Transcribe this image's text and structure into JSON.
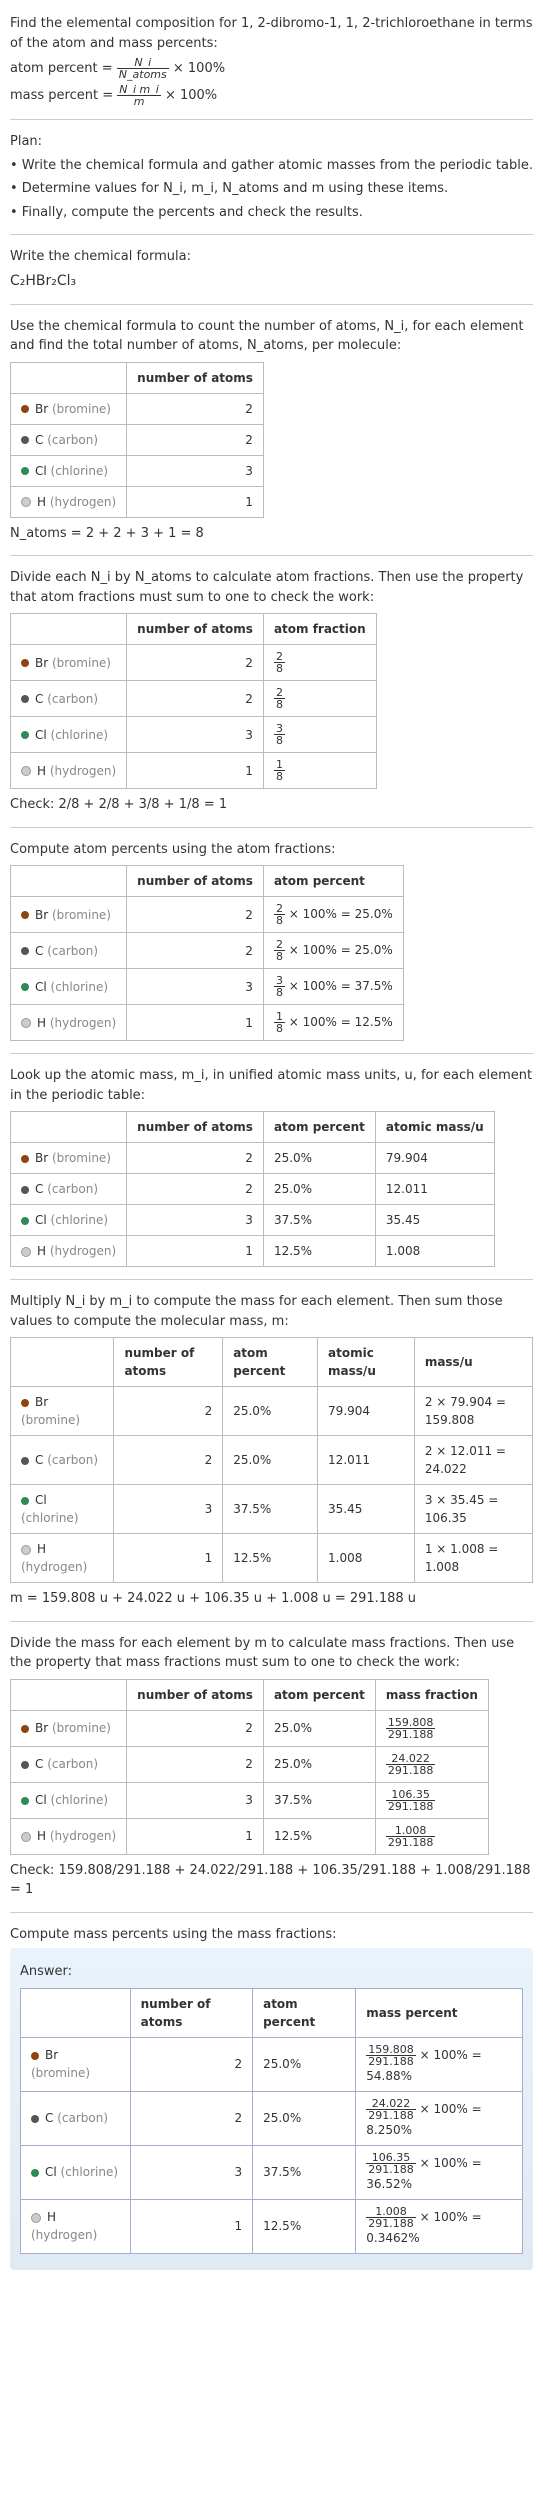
{
  "intro": {
    "title": "Find the elemental composition for 1, 2-dibromo-1, 1, 2-trichloroethane in terms of the atom and mass percents:",
    "atom_percent_label": "atom percent =",
    "atom_percent_formula_n": "N_i",
    "atom_percent_formula_d": "N_atoms",
    "times100": "× 100%",
    "mass_percent_label": "mass percent =",
    "mass_percent_formula_n": "N_i m_i",
    "mass_percent_formula_d": "m"
  },
  "plan": {
    "heading": "Plan:",
    "b1": "• Write the chemical formula and gather atomic masses from the periodic table.",
    "b2": "• Determine values for N_i, m_i, N_atoms and m using these items.",
    "b3": "• Finally, compute the percents and check the results."
  },
  "formula_sec": {
    "heading": "Write the chemical formula:",
    "formula": "C₂HBr₂Cl₃"
  },
  "count_sec": {
    "heading": "Use the chemical formula to count the number of atoms, N_i, for each element and find the total number of atoms, N_atoms, per molecule:",
    "sum": "N_atoms = 2 + 2 + 3 + 1 = 8"
  },
  "atomfrac_sec": {
    "heading": "Divide each N_i by N_atoms to calculate atom fractions. Then use the property that atom fractions must sum to one to check the work:",
    "check": "Check: 2/8 + 2/8 + 3/8 + 1/8 = 1"
  },
  "atompct_sec": {
    "heading": "Compute atom percents using the atom fractions:"
  },
  "mass_lookup": {
    "heading": "Look up the atomic mass, m_i, in unified atomic mass units, u, for each element in the periodic table:"
  },
  "molmass": {
    "heading": "Multiply N_i by m_i to compute the mass for each element. Then sum those values to compute the molecular mass, m:",
    "sum": "m = 159.808 u + 24.022 u + 106.35 u + 1.008 u = 291.188 u"
  },
  "massfrac_sec": {
    "heading": "Divide the mass for each element by m to calculate mass fractions. Then use the property that mass fractions must sum to one to check the work:",
    "check": "Check: 159.808/291.188 + 24.022/291.188 + 106.35/291.188 + 1.008/291.188 = 1"
  },
  "masspct_sec": {
    "heading": "Compute mass percents using the mass fractions:"
  },
  "answer_label": "Answer:",
  "cols": {
    "num_atoms": "number of atoms",
    "atom_frac": "atom fraction",
    "atom_pct": "atom percent",
    "atomic_mass": "atomic mass/u",
    "mass_u": "mass/u",
    "mass_frac": "mass fraction",
    "mass_pct": "mass percent"
  },
  "elements": [
    {
      "dot": "br-dot",
      "name": "Br",
      "paren": "(bromine)",
      "n": "2",
      "frac_n": "2",
      "frac_d": "8",
      "pct": "25.0%",
      "am": "79.904",
      "mass_calc": "2 × 79.904 = 159.808",
      "mass": "159.808",
      "mpct": "54.88%"
    },
    {
      "dot": "c-dot",
      "name": "C",
      "paren": "(carbon)",
      "n": "2",
      "frac_n": "2",
      "frac_d": "8",
      "pct": "25.0%",
      "am": "12.011",
      "mass_calc": "2 × 12.011 = 24.022",
      "mass": "24.022",
      "mpct": "8.250%"
    },
    {
      "dot": "cl-dot",
      "name": "Cl",
      "paren": "(chlorine)",
      "n": "3",
      "frac_n": "3",
      "frac_d": "8",
      "pct": "37.5%",
      "am": "35.45",
      "mass_calc": "3 × 35.45 = 106.35",
      "mass": "106.35",
      "mpct": "36.52%"
    },
    {
      "dot": "h-dot",
      "name": "H",
      "paren": "(hydrogen)",
      "n": "1",
      "frac_n": "1",
      "frac_d": "8",
      "pct": "12.5%",
      "am": "1.008",
      "mass_calc": "1 × 1.008 = 1.008",
      "mass": "1.008",
      "mpct": "0.3462%"
    }
  ],
  "chart_data": {
    "type": "table",
    "title": "Elemental composition of C2HBr2Cl3",
    "N_atoms": 8,
    "molecular_mass_u": 291.188,
    "rows": [
      {
        "element": "Br",
        "atoms": 2,
        "atom_percent": 25.0,
        "atomic_mass": 79.904,
        "mass_u": 159.808,
        "mass_percent": 54.88
      },
      {
        "element": "C",
        "atoms": 2,
        "atom_percent": 25.0,
        "atomic_mass": 12.011,
        "mass_u": 24.022,
        "mass_percent": 8.25
      },
      {
        "element": "Cl",
        "atoms": 3,
        "atom_percent": 37.5,
        "atomic_mass": 35.45,
        "mass_u": 106.35,
        "mass_percent": 36.52
      },
      {
        "element": "H",
        "atoms": 1,
        "atom_percent": 12.5,
        "atomic_mass": 1.008,
        "mass_u": 1.008,
        "mass_percent": 0.3462
      }
    ]
  }
}
